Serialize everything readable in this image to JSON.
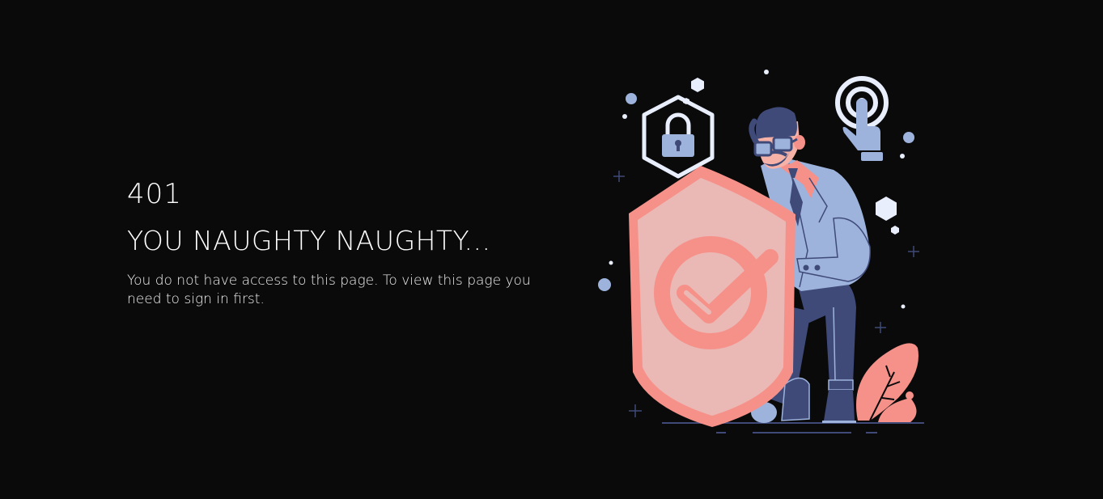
{
  "error": {
    "code": "401",
    "headline": "YOU NAUGHTY NAUGHTY...",
    "message_before_link": "You do not have access to this page. To view this page you need to ",
    "link_text": "sign in",
    "message_after_link": " first."
  },
  "colors": {
    "background": "#0a0a0b",
    "text": "#ffffff",
    "shield_outer": "#f6918a",
    "shield_inner": "#eab9b6",
    "suit": "#9db3dc",
    "dark_navy": "#3f4a78",
    "icon_white": "#e8eefb"
  },
  "illustration": {
    "icons": [
      "lock-icon",
      "touch-icon",
      "shield-check-icon"
    ]
  }
}
